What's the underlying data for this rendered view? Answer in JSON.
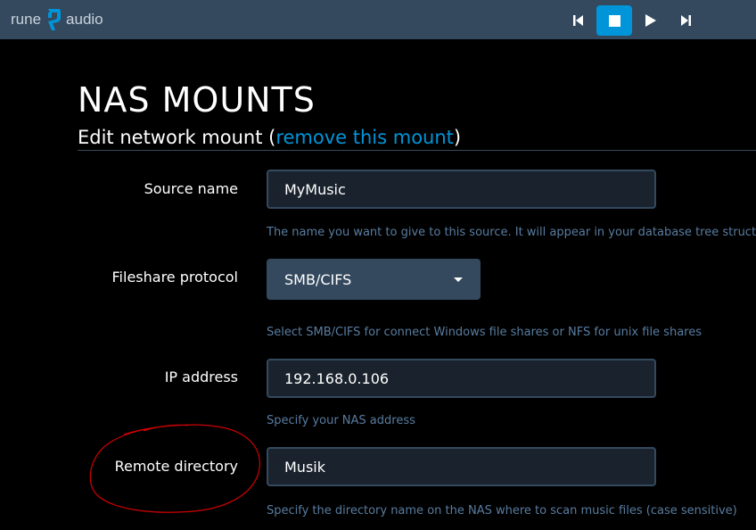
{
  "app": {
    "logo_left": "rune",
    "logo_right": "audio"
  },
  "playback": {
    "buttons": [
      "previous-icon",
      "stop-icon",
      "play-icon",
      "next-icon"
    ],
    "active": "stop-icon"
  },
  "page": {
    "title": "NAS MOUNTS",
    "section_prefix": "Edit network mount (",
    "section_link": "remove this mount",
    "section_suffix": ")"
  },
  "form": {
    "source_name": {
      "label": "Source name",
      "value": "MyMusic",
      "help": "The name you want to give to this source. It will appear in your database tree structure"
    },
    "protocol": {
      "label": "Fileshare protocol",
      "value": "SMB/CIFS",
      "help": "Select SMB/CIFS for connect Windows file shares or NFS for unix file shares"
    },
    "ip_address": {
      "label": "IP address",
      "value": "192.168.0.106",
      "help": "Specify your NAS address"
    },
    "remote_directory": {
      "label": "Remote directory",
      "value": "Musik",
      "help": "Specify the directory name on the NAS where to scan music files (case sensitive)"
    }
  },
  "colors": {
    "topbar": "#34495e",
    "accent": "#0095d8",
    "help_text": "#587ca0",
    "annotation": "#d00000"
  }
}
